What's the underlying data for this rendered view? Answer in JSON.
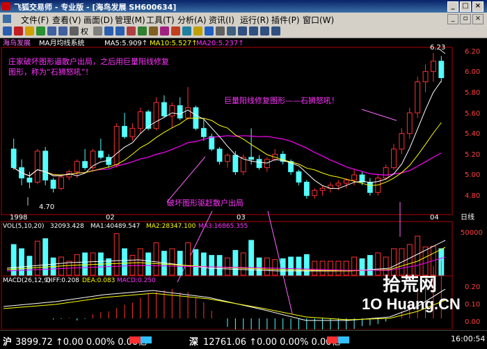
{
  "window": {
    "title": "飞狐交易师 - 专业版 - [海鸟发展 SH600634]",
    "min_label": "_",
    "max_label": "□",
    "close_label": "×"
  },
  "menu": {
    "items": [
      "文件(F)",
      "查看(V)",
      "画面(D)",
      "管理(M)",
      "工具(T)",
      "分析(A)",
      "资讯(I)",
      "运行(R)",
      "插件(P)",
      "窗口(W)"
    ],
    "doc_min_label": "_",
    "doc_max_label": "▫",
    "doc_close_label": "×"
  },
  "toolbar": {
    "right_label": "权"
  },
  "chart": {
    "header": {
      "name": "海鸟发展",
      "indicator": "MA月均线系统",
      "ma5": "MA5:5.909↑",
      "ma10": "MA10:5.527↑",
      "ma20": "MA20:5.237↑"
    },
    "price_ticks": [
      "6.20",
      "6.00",
      "5.80",
      "5.60",
      "5.40",
      "5.20",
      "5.00",
      "4.80"
    ],
    "label_high": "6.23",
    "label_low": "4.70",
    "x_labels": [
      "1998",
      "02",
      "03",
      "04"
    ],
    "period_label": "日线",
    "vol_header": {
      "vol": "VOL(5,10,20)",
      "value": "32093.428",
      "ma1": "MA1:40489.547",
      "ma2": "MA2:28347.100",
      "ma3": "MA3:16865.355"
    },
    "vol_tick": "50000",
    "macd_header": {
      "macd": "MACD(26,12,9)",
      "diff": "DIFF:0.208",
      "dea": "DEA:0.083",
      "macd_val": "MACD:0.250"
    },
    "macd_ticks": [
      "0.20",
      "0.10",
      "0.00"
    ],
    "annotations": {
      "top_left_line1": "庄家破坏图形逼散户出局，之后用巨量阳线修复",
      "top_left_line2": "图形，称为“石狮怒吼”！",
      "right": "巨量阳线修复图形——石狮怒吼！",
      "bottom": "破坏图形驱赶散户出局"
    },
    "colors": {
      "up": "#ff3030",
      "down": "#54ffff",
      "ma5": "#ffffff",
      "ma10": "#ffff00",
      "ma20": "#ff00ff",
      "axis": "#b00000",
      "annotation": "#ff33ff"
    }
  },
  "chart_data": {
    "type": "candlestick",
    "title": "海鸟发展",
    "price_ylim": [
      4.7,
      6.25
    ],
    "candles": [
      [
        5.3,
        5.4,
        5.1,
        5.12
      ],
      [
        5.12,
        5.2,
        4.95,
        5.02
      ],
      [
        5.02,
        5.08,
        4.92,
        4.98
      ],
      [
        4.98,
        5.3,
        4.96,
        5.28
      ],
      [
        5.28,
        5.32,
        4.95,
        5.0
      ],
      [
        5.0,
        5.02,
        4.88,
        4.92
      ],
      [
        4.92,
        5.05,
        4.9,
        5.03
      ],
      [
        5.03,
        5.1,
        5.0,
        5.08
      ],
      [
        5.08,
        5.2,
        5.02,
        5.18
      ],
      [
        5.18,
        5.3,
        5.1,
        5.12
      ],
      [
        5.12,
        5.3,
        5.1,
        5.28
      ],
      [
        5.28,
        5.4,
        5.2,
        5.22
      ],
      [
        5.22,
        5.25,
        5.12,
        5.15
      ],
      [
        5.15,
        5.55,
        5.12,
        5.52
      ],
      [
        5.52,
        5.65,
        5.4,
        5.42
      ],
      [
        5.42,
        5.55,
        5.38,
        5.5
      ],
      [
        5.5,
        5.7,
        5.45,
        5.66
      ],
      [
        5.66,
        5.68,
        5.48,
        5.5
      ],
      [
        5.5,
        5.8,
        5.48,
        5.75
      ],
      [
        5.75,
        5.82,
        5.6,
        5.62
      ],
      [
        5.62,
        5.75,
        5.5,
        5.72
      ],
      [
        5.72,
        5.8,
        5.58,
        5.6
      ],
      [
        5.6,
        5.9,
        5.58,
        5.7
      ],
      [
        5.7,
        5.72,
        5.48,
        5.5
      ],
      [
        5.5,
        5.58,
        5.38,
        5.42
      ],
      [
        5.42,
        5.45,
        5.28,
        5.3
      ],
      [
        5.3,
        5.32,
        5.15,
        5.18
      ],
      [
        5.18,
        5.26,
        5.12,
        5.24
      ],
      [
        5.24,
        5.28,
        5.05,
        5.08
      ],
      [
        5.08,
        5.25,
        5.05,
        5.22
      ],
      [
        5.22,
        5.5,
        5.15,
        5.2
      ],
      [
        5.2,
        5.24,
        5.1,
        5.12
      ],
      [
        5.12,
        5.22,
        5.08,
        5.2
      ],
      [
        5.2,
        5.3,
        5.18,
        5.25
      ],
      [
        5.25,
        5.28,
        5.15,
        5.18
      ],
      [
        5.18,
        5.2,
        5.05,
        5.08
      ],
      [
        5.08,
        5.1,
        4.95,
        4.98
      ],
      [
        4.98,
        5.0,
        4.82,
        4.85
      ],
      [
        4.85,
        4.92,
        4.82,
        4.9
      ],
      [
        4.9,
        4.95,
        4.85,
        4.92
      ],
      [
        4.92,
        4.98,
        4.88,
        4.95
      ],
      [
        4.95,
        5.0,
        4.9,
        4.97
      ],
      [
        4.97,
        5.02,
        4.92,
        5.0
      ],
      [
        5.0,
        5.1,
        4.95,
        5.05
      ],
      [
        5.05,
        5.08,
        4.95,
        4.98
      ],
      [
        4.98,
        5.02,
        4.85,
        4.88
      ],
      [
        4.88,
        5.05,
        4.85,
        5.02
      ],
      [
        5.02,
        5.15,
        5.0,
        5.12
      ],
      [
        5.12,
        5.35,
        5.1,
        5.3
      ],
      [
        5.3,
        5.5,
        5.25,
        5.45
      ],
      [
        5.45,
        5.7,
        5.4,
        5.65
      ],
      [
        5.65,
        6.0,
        5.6,
        5.95
      ],
      [
        5.95,
        6.12,
        5.85,
        6.05
      ],
      [
        6.05,
        6.23,
        5.95,
        6.15
      ],
      [
        6.15,
        6.2,
        5.95,
        5.99
      ]
    ],
    "macd_ylim": [
      -0.05,
      0.25
    ]
  }
}
